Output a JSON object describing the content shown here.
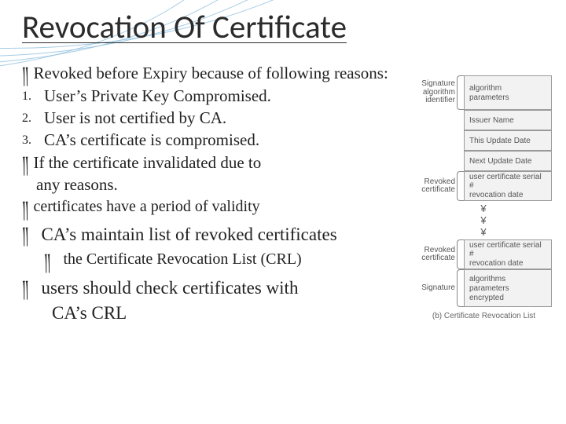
{
  "title": "Revocation Of Certificate",
  "bullet_glyph": "༎",
  "body": {
    "b1": "Revoked before Expiry because of following reasons:",
    "n1": "User’s Private Key Compromised.",
    "n2": "User is not certified by CA.",
    "n3": "CA’s certificate is compromised.",
    "b2a": "If the certificate invalidated due to",
    "b2b": "any reasons.",
    "b3": "certificates have a period of validity",
    "b4": "CA’s maintain list of revoked certificates",
    "b4sub": "the Certificate Revocation List (CRL)",
    "b5a": "users should check certificates with",
    "b5b": "CA’s CRL"
  },
  "diagram": {
    "sig_top_label": "Signature\nalgorithm\nidentifier",
    "sig_top_items": [
      "algorithm",
      "parameters"
    ],
    "issuer": "Issuer Name",
    "this_update": "This Update Date",
    "next_update": "Next Update Date",
    "revoked_label": "Revoked\ncertificate",
    "revoked_items": [
      "user certificate serial #",
      "revocation date"
    ],
    "dots": "¥\n¥\n¥",
    "sig_bottom_label": "Signature",
    "sig_bottom_items": [
      "algorithms",
      "parameters",
      "encrypted"
    ],
    "caption": "(b) Certificate Revocation List"
  }
}
